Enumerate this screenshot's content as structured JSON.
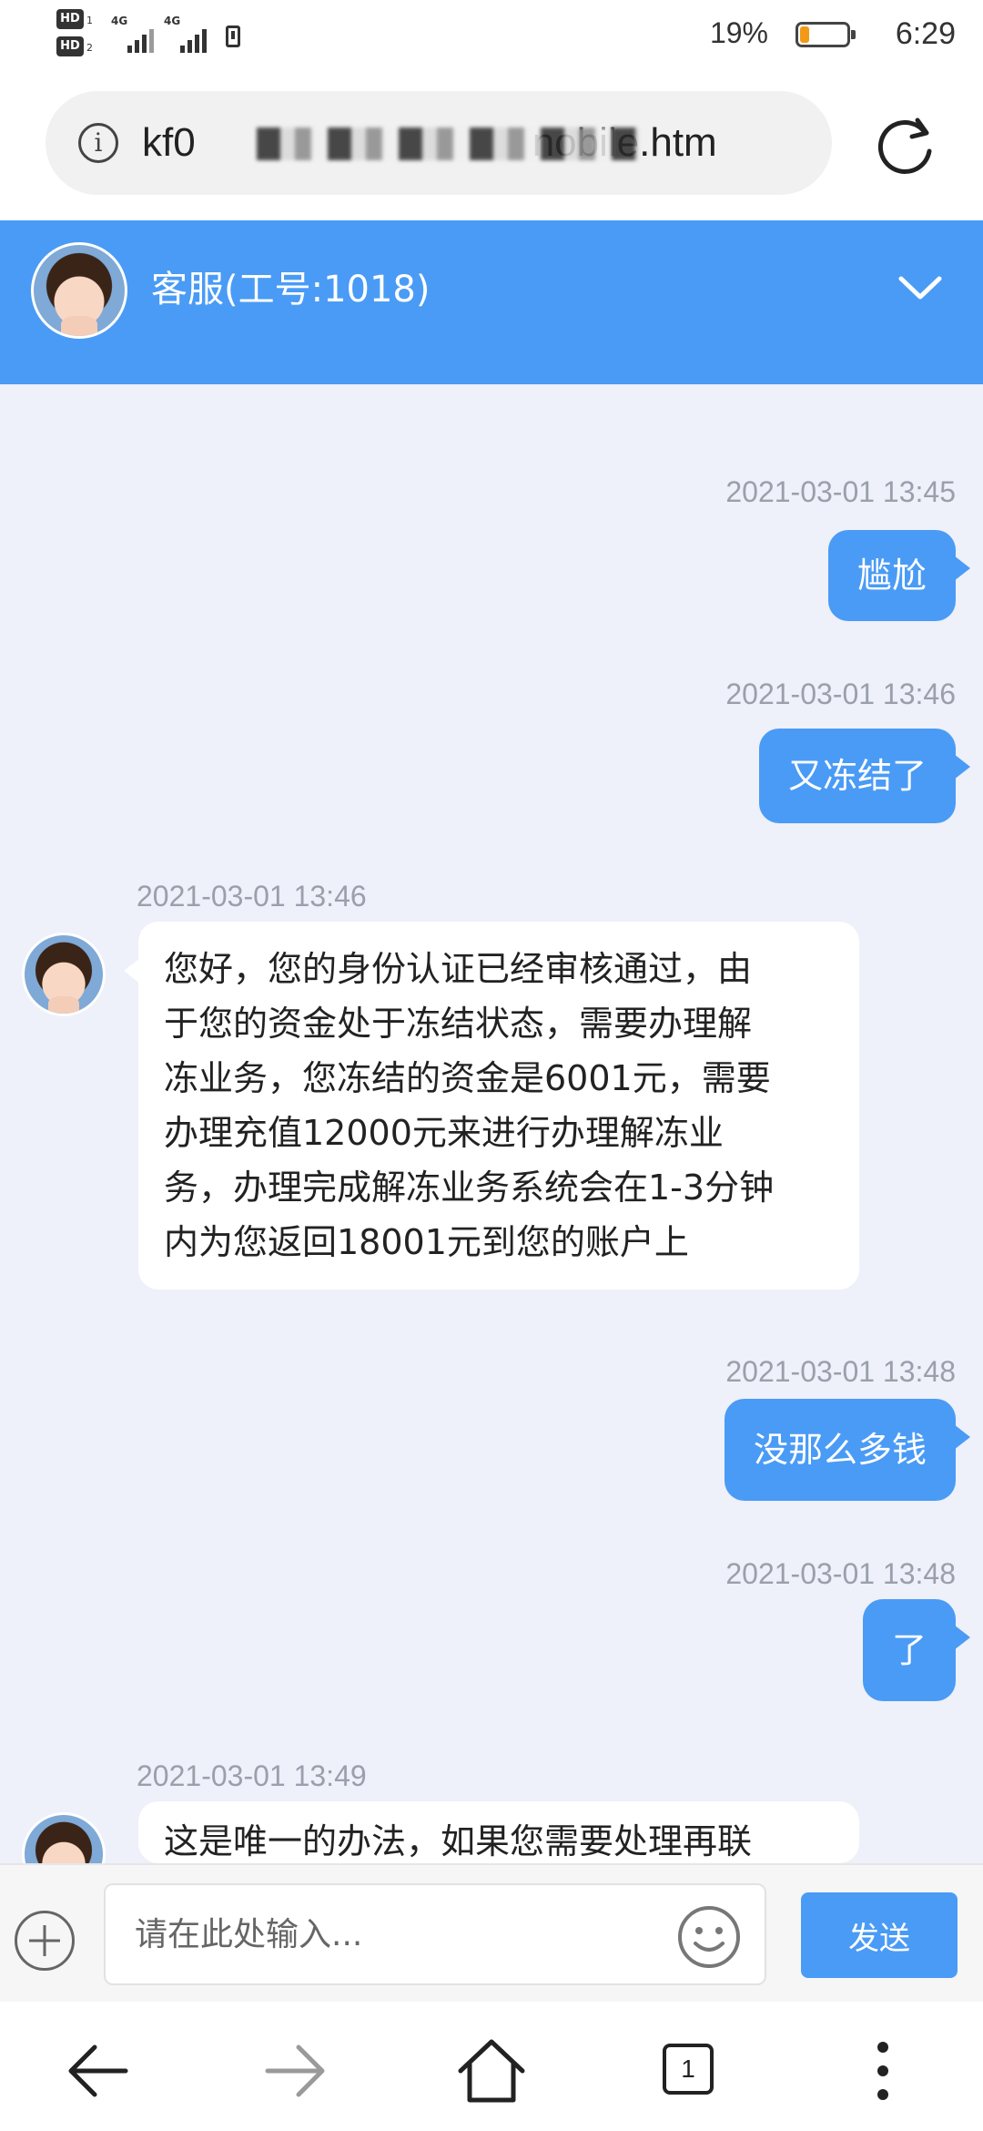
{
  "status_bar": {
    "hd_labels": [
      "HD",
      "HD"
    ],
    "sim_slots": [
      "1",
      "2"
    ],
    "network": [
      "4G",
      "4G"
    ],
    "battery_percent": "19%",
    "battery_level": 0.19,
    "battery_color": "#f29a18",
    "time": "6:29"
  },
  "browser": {
    "url_prefix": "kf0",
    "url_suffix": "nobile.htm",
    "info_icon": "i"
  },
  "header": {
    "title": "客服(工号:1018)",
    "background": "#4a9bf5"
  },
  "messages": [
    {
      "from": "user",
      "time": "2021-03-01 13:45",
      "text": "尴尬"
    },
    {
      "from": "user",
      "time": "2021-03-01 13:46",
      "text": "又冻结了"
    },
    {
      "from": "agent",
      "time": "2021-03-01 13:46",
      "lines": [
        "您好，您的身份认证已经审核通过，由",
        "于您的资金处于冻结状态，需要办理解",
        "冻业务，您冻结的资金是6001元，需要",
        "办理充值12000元来进行办理解冻业",
        "务，办理完成解冻业务系统会在1-3分钟",
        "内为您返回18001元到您的账户上"
      ]
    },
    {
      "from": "user",
      "time": "2021-03-01 13:48",
      "text": "没那么多钱"
    },
    {
      "from": "user",
      "time": "2021-03-01 13:48",
      "text": "了"
    },
    {
      "from": "agent",
      "time": "2021-03-01 13:49",
      "lines": [
        "这是唯一的办法，如果您需要处理再联"
      ]
    }
  ],
  "input_bar": {
    "placeholder": "请在此处输入...",
    "send_label": "发送"
  },
  "nav": {
    "tab_count": "1",
    "icons": [
      "back-arrow-icon",
      "forward-arrow-icon",
      "home-icon",
      "tabs-icon",
      "more-vertical-icon"
    ]
  }
}
